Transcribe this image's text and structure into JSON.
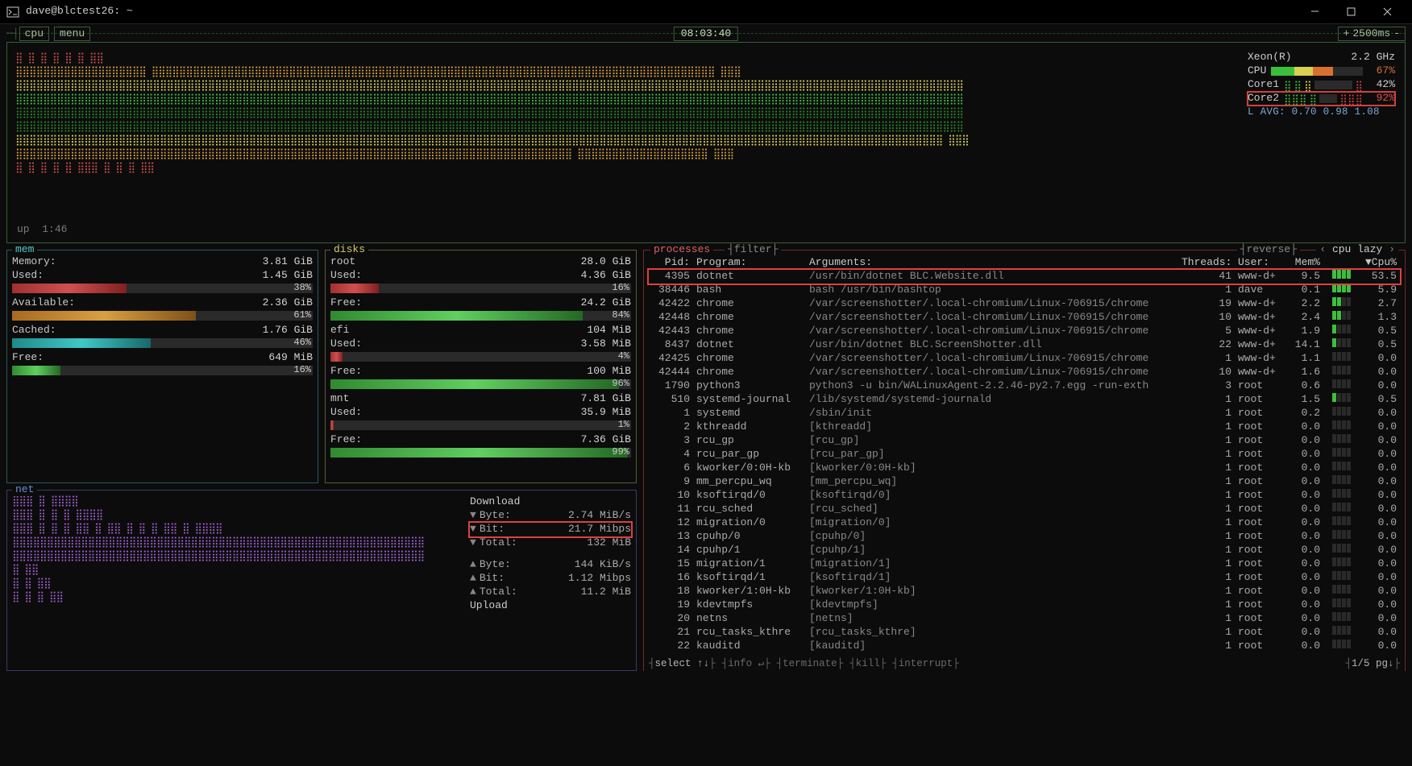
{
  "window": {
    "title": "dave@blctest26: ~"
  },
  "top": {
    "btn_cpu": "cpu",
    "btn_menu": "menu",
    "clock": "08:03:40",
    "refresh_prefix": "+",
    "refresh_value": "2500ms",
    "refresh_suffix": "-"
  },
  "uptime_label": "up",
  "uptime_value": "1:46",
  "cpu_side": {
    "model": "Xeon(R)",
    "speed": "2.2 GHz",
    "label_cpu": "CPU",
    "pct_cpu": "67%",
    "label_core1": "Core1",
    "pct_core1": "42%",
    "label_core2": "Core2",
    "pct_core2": "92%",
    "lavg": "L AVG: 0.70 0.98 1.08"
  },
  "mem": {
    "title": "mem",
    "memory_label": "Memory:",
    "memory_val": "3.81 GiB",
    "used_label": "Used:",
    "used_val": "1.45 GiB",
    "used_pct": "38%",
    "available_label": "Available:",
    "available_val": "2.36 GiB",
    "available_pct": "61%",
    "cached_label": "Cached:",
    "cached_val": "1.76 GiB",
    "cached_pct": "46%",
    "free_label": "Free:",
    "free_val": "649 MiB",
    "free_pct": "16%"
  },
  "disks": {
    "title": "disks",
    "items": [
      {
        "name": "root",
        "total": "28.0 GiB",
        "used_label": "Used:",
        "used_val": "4.36 GiB",
        "used_pct": "16%",
        "free_label": "Free:",
        "free_val": "24.2 GiB",
        "free_pct": "84%"
      },
      {
        "name": "efi",
        "total": "104 MiB",
        "used_label": "Used:",
        "used_val": "3.58 MiB",
        "used_pct": "4%",
        "free_label": "Free:",
        "free_val": "100 MiB",
        "free_pct": "96%"
      },
      {
        "name": "mnt",
        "total": "7.81 GiB",
        "used_label": "Used:",
        "used_val": "35.9 MiB",
        "used_pct": "1%",
        "free_label": "Free:",
        "free_val": "7.36 GiB",
        "free_pct": "99%"
      }
    ]
  },
  "net": {
    "title": "net",
    "download_label": "Download",
    "dl_byte_label": "Byte:",
    "dl_byte_val": "2.74 MiB/s",
    "dl_bit_label": "Bit:",
    "dl_bit_val": "21.7 Mibps",
    "dl_total_label": "Total:",
    "dl_total_val": "132 MiB",
    "ul_byte_label": "Byte:",
    "ul_byte_val": "144 KiB/s",
    "ul_bit_label": "Bit:",
    "ul_bit_val": "1.12 Mibps",
    "ul_total_label": "Total:",
    "ul_total_val": "11.2 MiB",
    "upload_label": "Upload"
  },
  "proc": {
    "title": "processes",
    "filter_label": "filter",
    "reverse_label": "reverse",
    "sort_left": "‹",
    "sort_mode": "cpu lazy",
    "sort_right": "›",
    "col_pid": "Pid:",
    "col_program": "Program:",
    "col_args": "Arguments:",
    "col_threads": "Threads:",
    "col_user": "User:",
    "col_mem": "Mem%",
    "col_cpu": "▼Cpu%",
    "rows": [
      {
        "pid": "4395",
        "prog": "dotnet",
        "args": "/usr/bin/dotnet BLC.Website.dll",
        "thr": "41",
        "usr": "www-d+",
        "mem": "9.5",
        "cpu": "53.5",
        "hl": true
      },
      {
        "pid": "38446",
        "prog": "bash",
        "args": "bash /usr/bin/bashtop",
        "thr": "1",
        "usr": "dave",
        "mem": "0.1",
        "cpu": "5.9"
      },
      {
        "pid": "42422",
        "prog": "chrome",
        "args": "/var/screenshotter/.local-chromium/Linux-706915/chrome",
        "thr": "19",
        "usr": "www-d+",
        "mem": "2.2",
        "cpu": "2.7"
      },
      {
        "pid": "42448",
        "prog": "chrome",
        "args": "/var/screenshotter/.local-chromium/Linux-706915/chrome",
        "thr": "10",
        "usr": "www-d+",
        "mem": "2.4",
        "cpu": "1.3"
      },
      {
        "pid": "42443",
        "prog": "chrome",
        "args": "/var/screenshotter/.local-chromium/Linux-706915/chrome",
        "thr": "5",
        "usr": "www-d+",
        "mem": "1.9",
        "cpu": "0.5"
      },
      {
        "pid": "8437",
        "prog": "dotnet",
        "args": "/usr/bin/dotnet BLC.ScreenShotter.dll",
        "thr": "22",
        "usr": "www-d+",
        "mem": "14.1",
        "cpu": "0.5"
      },
      {
        "pid": "42425",
        "prog": "chrome",
        "args": "/var/screenshotter/.local-chromium/Linux-706915/chrome",
        "thr": "1",
        "usr": "www-d+",
        "mem": "1.1",
        "cpu": "0.0"
      },
      {
        "pid": "42444",
        "prog": "chrome",
        "args": "/var/screenshotter/.local-chromium/Linux-706915/chrome",
        "thr": "10",
        "usr": "www-d+",
        "mem": "1.6",
        "cpu": "0.0"
      },
      {
        "pid": "1790",
        "prog": "python3",
        "args": "python3 -u bin/WALinuxAgent-2.2.46-py2.7.egg -run-exth",
        "thr": "3",
        "usr": "root",
        "mem": "0.6",
        "cpu": "0.0"
      },
      {
        "pid": "510",
        "prog": "systemd-journal",
        "args": "/lib/systemd/systemd-journald",
        "thr": "1",
        "usr": "root",
        "mem": "1.5",
        "cpu": "0.5"
      },
      {
        "pid": "1",
        "prog": "systemd",
        "args": "/sbin/init",
        "thr": "1",
        "usr": "root",
        "mem": "0.2",
        "cpu": "0.0"
      },
      {
        "pid": "2",
        "prog": "kthreadd",
        "args": "[kthreadd]",
        "thr": "1",
        "usr": "root",
        "mem": "0.0",
        "cpu": "0.0"
      },
      {
        "pid": "3",
        "prog": "rcu_gp",
        "args": "[rcu_gp]",
        "thr": "1",
        "usr": "root",
        "mem": "0.0",
        "cpu": "0.0"
      },
      {
        "pid": "4",
        "prog": "rcu_par_gp",
        "args": "[rcu_par_gp]",
        "thr": "1",
        "usr": "root",
        "mem": "0.0",
        "cpu": "0.0"
      },
      {
        "pid": "6",
        "prog": "kworker/0:0H-kb",
        "args": "[kworker/0:0H-kb]",
        "thr": "1",
        "usr": "root",
        "mem": "0.0",
        "cpu": "0.0"
      },
      {
        "pid": "9",
        "prog": "mm_percpu_wq",
        "args": "[mm_percpu_wq]",
        "thr": "1",
        "usr": "root",
        "mem": "0.0",
        "cpu": "0.0"
      },
      {
        "pid": "10",
        "prog": "ksoftirqd/0",
        "args": "[ksoftirqd/0]",
        "thr": "1",
        "usr": "root",
        "mem": "0.0",
        "cpu": "0.0"
      },
      {
        "pid": "11",
        "prog": "rcu_sched",
        "args": "[rcu_sched]",
        "thr": "1",
        "usr": "root",
        "mem": "0.0",
        "cpu": "0.0"
      },
      {
        "pid": "12",
        "prog": "migration/0",
        "args": "[migration/0]",
        "thr": "1",
        "usr": "root",
        "mem": "0.0",
        "cpu": "0.0"
      },
      {
        "pid": "13",
        "prog": "cpuhp/0",
        "args": "[cpuhp/0]",
        "thr": "1",
        "usr": "root",
        "mem": "0.0",
        "cpu": "0.0"
      },
      {
        "pid": "14",
        "prog": "cpuhp/1",
        "args": "[cpuhp/1]",
        "thr": "1",
        "usr": "root",
        "mem": "0.0",
        "cpu": "0.0"
      },
      {
        "pid": "15",
        "prog": "migration/1",
        "args": "[migration/1]",
        "thr": "1",
        "usr": "root",
        "mem": "0.0",
        "cpu": "0.0"
      },
      {
        "pid": "16",
        "prog": "ksoftirqd/1",
        "args": "[ksoftirqd/1]",
        "thr": "1",
        "usr": "root",
        "mem": "0.0",
        "cpu": "0.0"
      },
      {
        "pid": "18",
        "prog": "kworker/1:0H-kb",
        "args": "[kworker/1:0H-kb]",
        "thr": "1",
        "usr": "root",
        "mem": "0.0",
        "cpu": "0.0"
      },
      {
        "pid": "19",
        "prog": "kdevtmpfs",
        "args": "[kdevtmpfs]",
        "thr": "1",
        "usr": "root",
        "mem": "0.0",
        "cpu": "0.0"
      },
      {
        "pid": "20",
        "prog": "netns",
        "args": "[netns]",
        "thr": "1",
        "usr": "root",
        "mem": "0.0",
        "cpu": "0.0"
      },
      {
        "pid": "21",
        "prog": "rcu_tasks_kthre",
        "args": "[rcu_tasks_kthre]",
        "thr": "1",
        "usr": "root",
        "mem": "0.0",
        "cpu": "0.0"
      },
      {
        "pid": "22",
        "prog": "kauditd",
        "args": "[kauditd]",
        "thr": "1",
        "usr": "root",
        "mem": "0.0",
        "cpu": "0.0"
      }
    ],
    "footer": {
      "select": "select ↑↓",
      "info": "info ↵",
      "terminate": "terminate",
      "kill": "kill",
      "interrupt": "interrupt",
      "page": "1/5 pg↓"
    }
  }
}
